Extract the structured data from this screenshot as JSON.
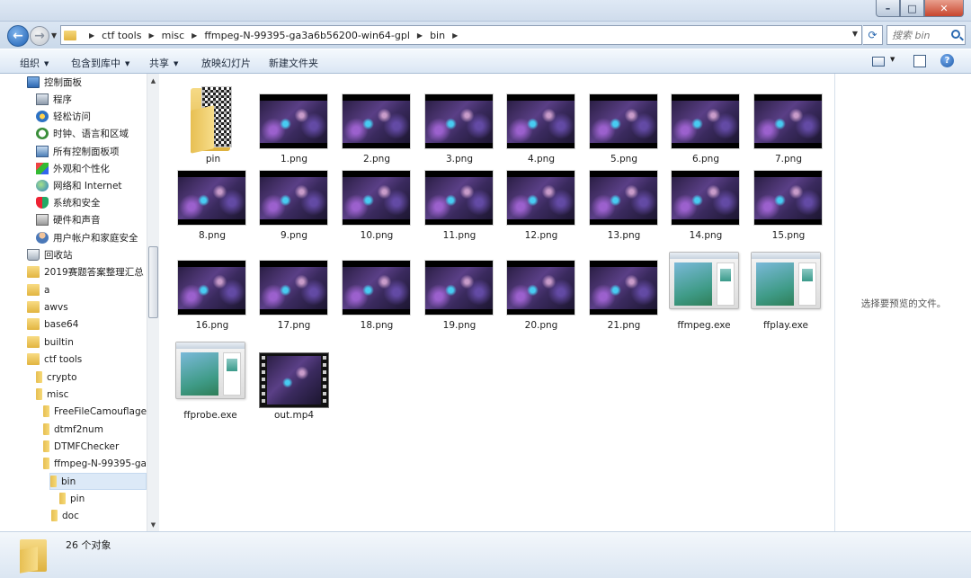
{
  "titlebar": {
    "minimize": "–",
    "maximize": "□",
    "close": "✕"
  },
  "breadcrumbs": [
    "ctf tools",
    "misc",
    "ffmpeg-N-99395-ga3a6b56200-win64-gpl",
    "bin"
  ],
  "search": {
    "placeholder": "搜索 bin"
  },
  "toolbar": {
    "organize": "组织",
    "include_in_library": "包含到库中",
    "share": "共享",
    "slideshow": "放映幻灯片",
    "new_folder": "新建文件夹",
    "help": "?"
  },
  "sidebar": {
    "items": [
      {
        "label": "控制面板",
        "icon": "control-panel-icon"
      },
      {
        "label": "程序",
        "icon": "programs-icon"
      },
      {
        "label": "轻松访问",
        "icon": "ease-of-access-icon"
      },
      {
        "label": "时钟、语言和区域",
        "icon": "clock-language-icon"
      },
      {
        "label": "所有控制面板项",
        "icon": "control-panel-items-icon"
      },
      {
        "label": "外观和个性化",
        "icon": "appearance-icon"
      },
      {
        "label": "网络和 Internet",
        "icon": "network-icon"
      },
      {
        "label": "系统和安全",
        "icon": "security-icon"
      },
      {
        "label": "硬件和声音",
        "icon": "hardware-icon"
      },
      {
        "label": "用户帐户和家庭安全",
        "icon": "user-accounts-icon"
      },
      {
        "label": "回收站",
        "icon": "recycle-bin-icon"
      },
      {
        "label": "2019赛题答案整理汇总",
        "icon": "folder-icon"
      },
      {
        "label": "a",
        "icon": "folder-icon"
      },
      {
        "label": "awvs",
        "icon": "folder-icon"
      },
      {
        "label": "base64",
        "icon": "folder-icon"
      },
      {
        "label": "builtin",
        "icon": "folder-icon"
      },
      {
        "label": "ctf tools",
        "icon": "folder-icon"
      },
      {
        "label": "crypto",
        "icon": "folder-icon"
      },
      {
        "label": "misc",
        "icon": "folder-icon"
      },
      {
        "label": "FreeFileCamouflage",
        "icon": "folder-icon"
      },
      {
        "label": "dtmf2num",
        "icon": "folder-icon"
      },
      {
        "label": "DTMFChecker",
        "icon": "folder-icon"
      },
      {
        "label": "ffmpeg-N-99395-ga",
        "icon": "folder-icon"
      },
      {
        "label": "bin",
        "icon": "folder-icon"
      },
      {
        "label": "pin",
        "icon": "folder-icon"
      },
      {
        "label": "doc",
        "icon": "folder-icon"
      }
    ]
  },
  "files": [
    {
      "name": "pin",
      "type": "folder"
    },
    {
      "name": "1.png",
      "type": "image"
    },
    {
      "name": "2.png",
      "type": "image"
    },
    {
      "name": "3.png",
      "type": "image"
    },
    {
      "name": "4.png",
      "type": "image"
    },
    {
      "name": "5.png",
      "type": "image"
    },
    {
      "name": "6.png",
      "type": "image"
    },
    {
      "name": "7.png",
      "type": "image"
    },
    {
      "name": "8.png",
      "type": "image"
    },
    {
      "name": "9.png",
      "type": "image"
    },
    {
      "name": "10.png",
      "type": "image"
    },
    {
      "name": "11.png",
      "type": "image"
    },
    {
      "name": "12.png",
      "type": "image"
    },
    {
      "name": "13.png",
      "type": "image"
    },
    {
      "name": "14.png",
      "type": "image"
    },
    {
      "name": "15.png",
      "type": "image"
    },
    {
      "name": "16.png",
      "type": "image"
    },
    {
      "name": "17.png",
      "type": "image"
    },
    {
      "name": "18.png",
      "type": "image"
    },
    {
      "name": "19.png",
      "type": "image"
    },
    {
      "name": "20.png",
      "type": "image"
    },
    {
      "name": "21.png",
      "type": "image"
    },
    {
      "name": "ffmpeg.exe",
      "type": "exe"
    },
    {
      "name": "ffplay.exe",
      "type": "exe"
    },
    {
      "name": "ffprobe.exe",
      "type": "exe"
    },
    {
      "name": "out.mp4",
      "type": "video"
    }
  ],
  "preview": {
    "text": "选择要预览的文件。"
  },
  "status": {
    "count": "26 个对象"
  }
}
